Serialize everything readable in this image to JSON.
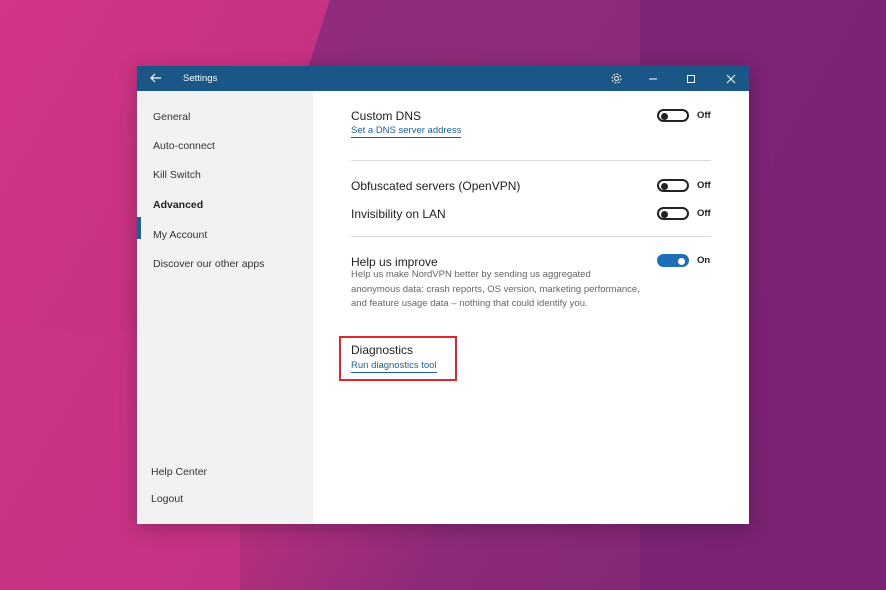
{
  "titlebar": {
    "back_icon": "arrow-left-icon",
    "title": "Settings",
    "gear_icon": "gear-icon",
    "minimize_icon": "minimize-icon",
    "maximize_icon": "maximize-icon",
    "close_icon": "close-icon"
  },
  "sidebar": {
    "items": [
      {
        "label": "General"
      },
      {
        "label": "Auto-connect"
      },
      {
        "label": "Kill Switch"
      },
      {
        "label": "Advanced",
        "active": true
      },
      {
        "label": "My Account"
      },
      {
        "label": "Discover our other apps"
      }
    ],
    "footer": [
      {
        "label": "Help Center"
      },
      {
        "label": "Logout"
      }
    ]
  },
  "settings": {
    "custom_dns": {
      "title": "Custom DNS",
      "link": "Set a DNS server address",
      "state": "Off"
    },
    "obfuscated": {
      "title": "Obfuscated servers (OpenVPN)",
      "state": "Off"
    },
    "invisibility": {
      "title": "Invisibility on LAN",
      "state": "Off"
    },
    "help_improve": {
      "title": "Help us improve",
      "state": "On",
      "description": "Help us make NordVPN better by sending us aggregated anonymous data: crash reports, OS version, marketing performance, and feature usage data – nothing that could identify you."
    },
    "diagnostics": {
      "title": "Diagnostics",
      "link": "Run diagnostics tool"
    }
  },
  "colors": {
    "titlebar": "#1a5787",
    "accent": "#1e6fb8",
    "highlight": "#e2262c"
  }
}
